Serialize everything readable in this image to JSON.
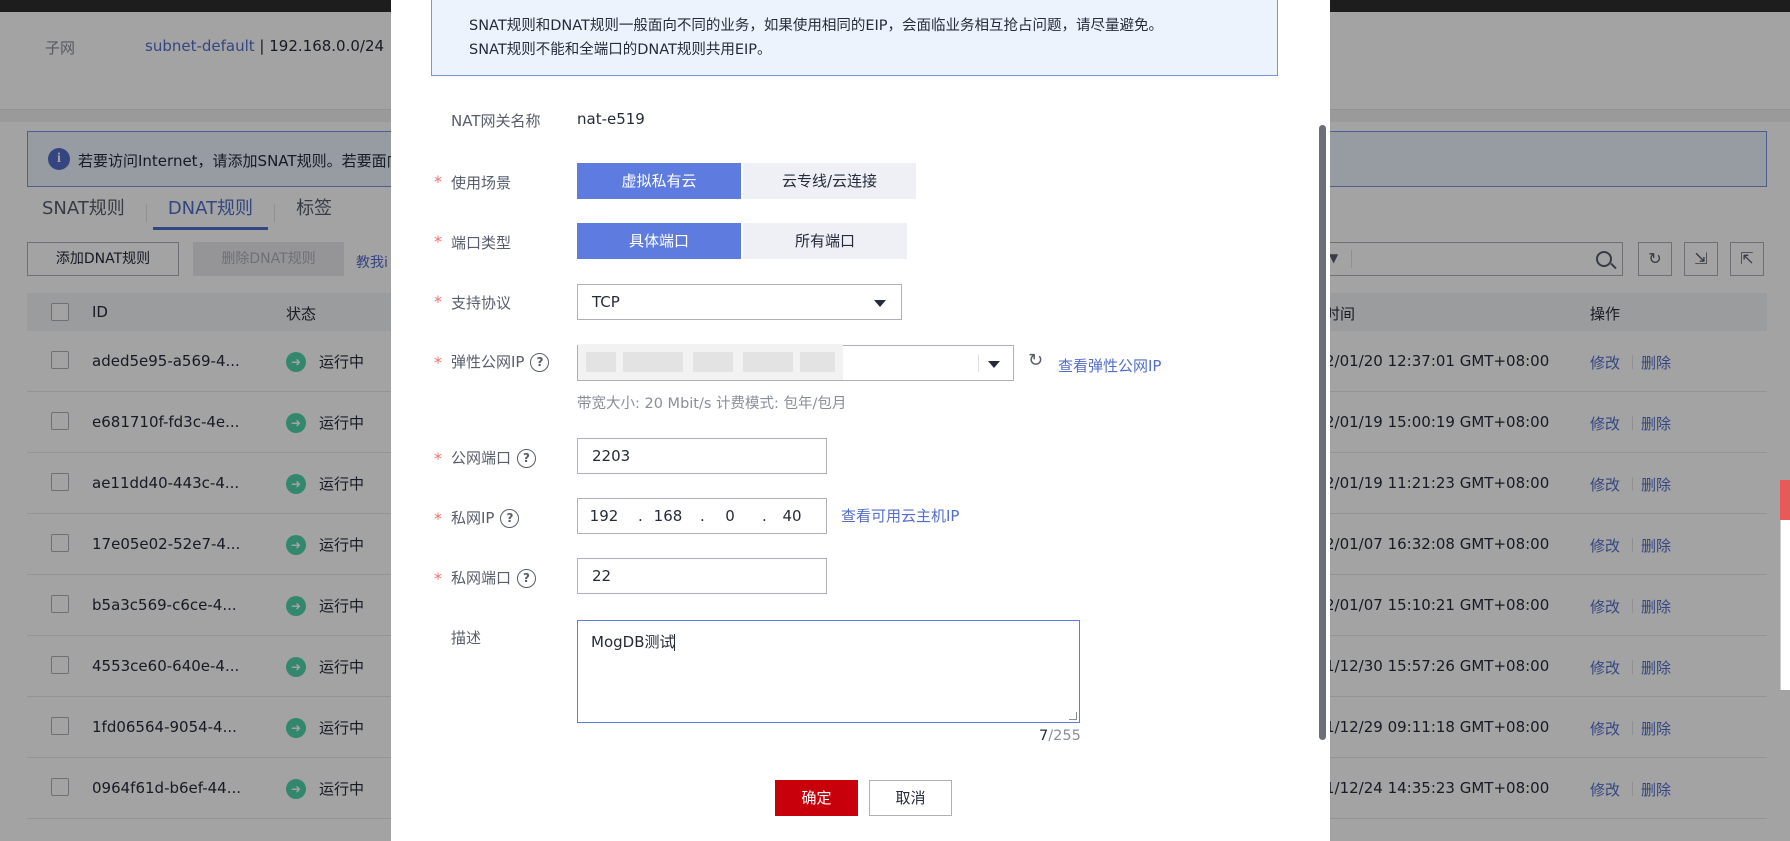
{
  "background": {
    "subnet_label": "子网",
    "subnet_link": "subnet-default",
    "subnet_cidr": " | 192.168.0.0/24",
    "notice_text": "若要访问Internet，请添加SNAT规则。若要面向",
    "tabs": [
      "SNAT规则",
      "DNAT规则",
      "标签"
    ],
    "add_button": "添加DNAT规则",
    "delete_button": "删除DNAT规则",
    "help_link": "教我i",
    "columns": {
      "id": "ID",
      "status": "状态",
      "created": "时间",
      "actions": "操作"
    },
    "rows": [
      {
        "id": "aded5e95-a569-4...",
        "status": "运行中",
        "time": "2/01/20 12:37:01 GMT+08:00"
      },
      {
        "id": "e681710f-fd3c-4e...",
        "status": "运行中",
        "time": "2/01/19 15:00:19 GMT+08:00"
      },
      {
        "id": "ae11dd40-443c-4...",
        "status": "运行中",
        "time": "2/01/19 11:21:23 GMT+08:00"
      },
      {
        "id": "17e05e02-52e7-4...",
        "status": "运行中",
        "time": "2/01/07 16:32:08 GMT+08:00"
      },
      {
        "id": "b5a3c569-c6ce-4...",
        "status": "运行中",
        "time": "2/01/07 15:10:21 GMT+08:00"
      },
      {
        "id": "4553ce60-640e-4...",
        "status": "运行中",
        "time": "1/12/30 15:57:26 GMT+08:00"
      },
      {
        "id": "1fd06564-9054-4...",
        "status": "运行中",
        "time": "1/12/29 09:11:18 GMT+08:00"
      },
      {
        "id": "0964f61d-b6ef-44...",
        "status": "运行中",
        "time": "1/12/24 14:35:23 GMT+08:00"
      }
    ],
    "edit_label": "修改",
    "delete_label": "删除"
  },
  "modal": {
    "tip_line1": "SNAT规则和DNAT规则一般面向不同的业务，如果使用相同的EIP，会面临业务相互抢占问题，请尽量避免。",
    "tip_line2": "SNAT规则不能和全端口的DNAT规则共用EIP。",
    "nat_name_label": "NAT网关名称",
    "nat_name_value": "nat-e519",
    "scenario_label": "使用场景",
    "scenario_options": [
      "虚拟私有云",
      "云专线/云连接"
    ],
    "port_type_label": "端口类型",
    "port_type_options": [
      "具体端口",
      "所有端口"
    ],
    "protocol_label": "支持协议",
    "protocol_value": "TCP",
    "eip_label": "弹性公网IP",
    "eip_link": "查看弹性公网IP",
    "eip_hint": "带宽大小: 20 Mbit/s  计费模式: 包年/包月",
    "public_port_label": "公网端口",
    "public_port_value": "2203",
    "private_ip_label": "私网IP",
    "private_ip": [
      "192",
      "168",
      "0",
      "40"
    ],
    "private_ip_link": "查看可用云主机IP",
    "private_port_label": "私网端口",
    "private_port_value": "22",
    "desc_label": "描述",
    "desc_value": "MogDB测试",
    "desc_count": "7",
    "desc_max": "/255",
    "ok_button": "确定",
    "cancel_button": "取消",
    "required_mark": "*",
    "help_mark": "?"
  }
}
